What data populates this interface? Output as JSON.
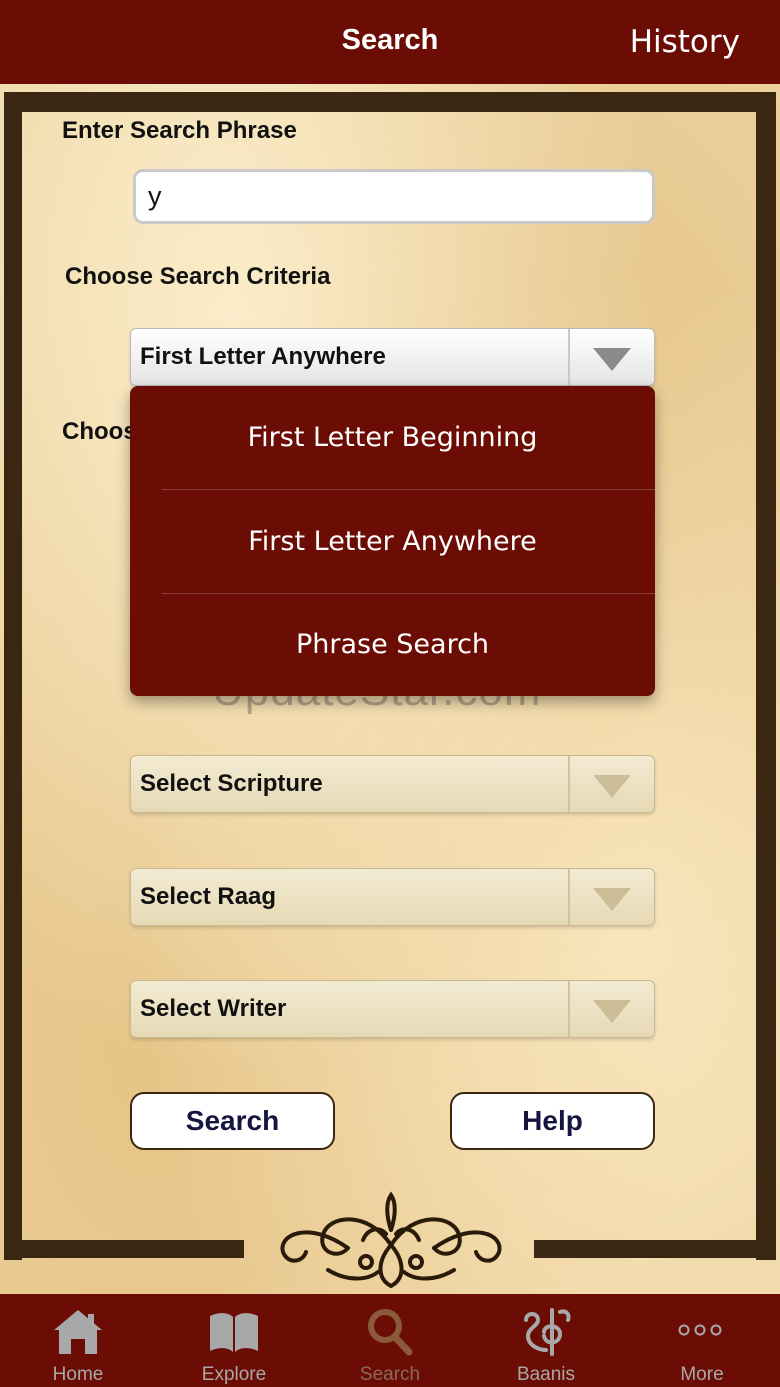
{
  "header": {
    "title": "Search",
    "history_label": "History"
  },
  "form": {
    "phrase_label": "Enter Search Phrase",
    "phrase_value": "y",
    "criteria_label": "Choose Search Criteria",
    "criteria_selected": "First Letter Anywhere",
    "hidden_label_fragment": "Choos",
    "scripture_placeholder": "Select Scripture",
    "raag_placeholder": "Select Raag",
    "writer_placeholder": "Select Writer"
  },
  "dropdown": {
    "options": [
      "First Letter Beginning",
      "First Letter Anywhere",
      "Phrase Search"
    ]
  },
  "watermark": "UpdateStar.com",
  "buttons": {
    "search": "Search",
    "help": "Help"
  },
  "tabbar": {
    "tabs": [
      {
        "label": "Home",
        "icon": "home-icon"
      },
      {
        "label": "Explore",
        "icon": "book-icon"
      },
      {
        "label": "Search",
        "icon": "search-icon",
        "selected": true
      },
      {
        "label": "Baanis",
        "icon": "khanda-icon"
      },
      {
        "label": "More",
        "icon": "more-icon"
      }
    ]
  },
  "colors": {
    "accent": "#6b0d05",
    "parchment": "#ecd29f",
    "frame": "#3a2712"
  }
}
